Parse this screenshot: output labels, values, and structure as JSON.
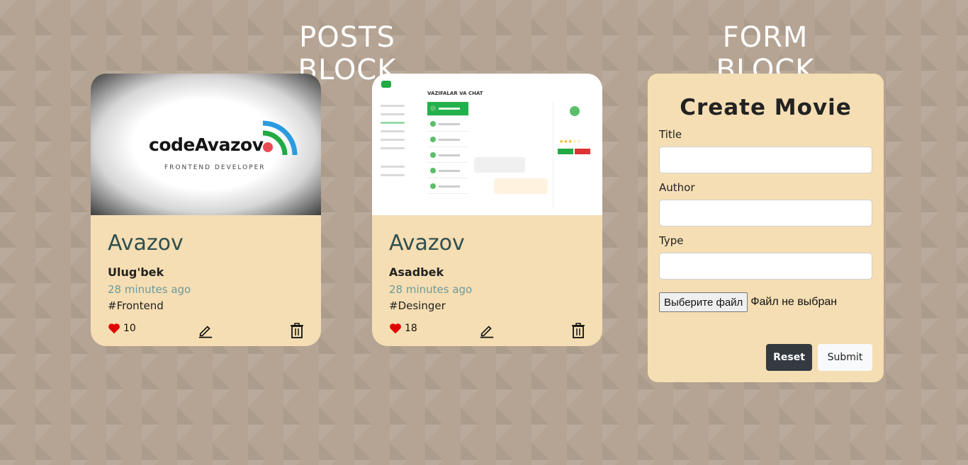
{
  "sections": {
    "posts_title": "POSTS BLOCK",
    "form_title": "FORM BLOCK"
  },
  "posts": [
    {
      "image": "codeAvazov logo",
      "logo_text": "codeAvazov",
      "logo_sub": "FRONTEND DEVELOPER",
      "title": "Avazov",
      "author": "Ulug'bek",
      "time": "28 minutes ago",
      "tag": "#Frontend",
      "likes": "10"
    },
    {
      "image": "dashboard screenshot",
      "dash_title": "VAZIFALAR VA CHAT",
      "title": "Avazov",
      "author": "Asadbek",
      "time": "28 minutes ago",
      "tag": "#Desinger",
      "likes": "18"
    }
  ],
  "form": {
    "heading": "Create Movie",
    "fields": [
      {
        "label": "Title",
        "value": ""
      },
      {
        "label": "Author",
        "value": ""
      },
      {
        "label": "Type",
        "value": ""
      }
    ],
    "file_button": "Выберите файл",
    "file_status": "Файл не выбран",
    "reset_label": "Reset",
    "submit_label": "Submit"
  },
  "colors": {
    "background": "#b5a493",
    "card": "#f5deb3",
    "title": "#2f4f4f",
    "time": "#6c9a9c",
    "like": "#e00000"
  }
}
